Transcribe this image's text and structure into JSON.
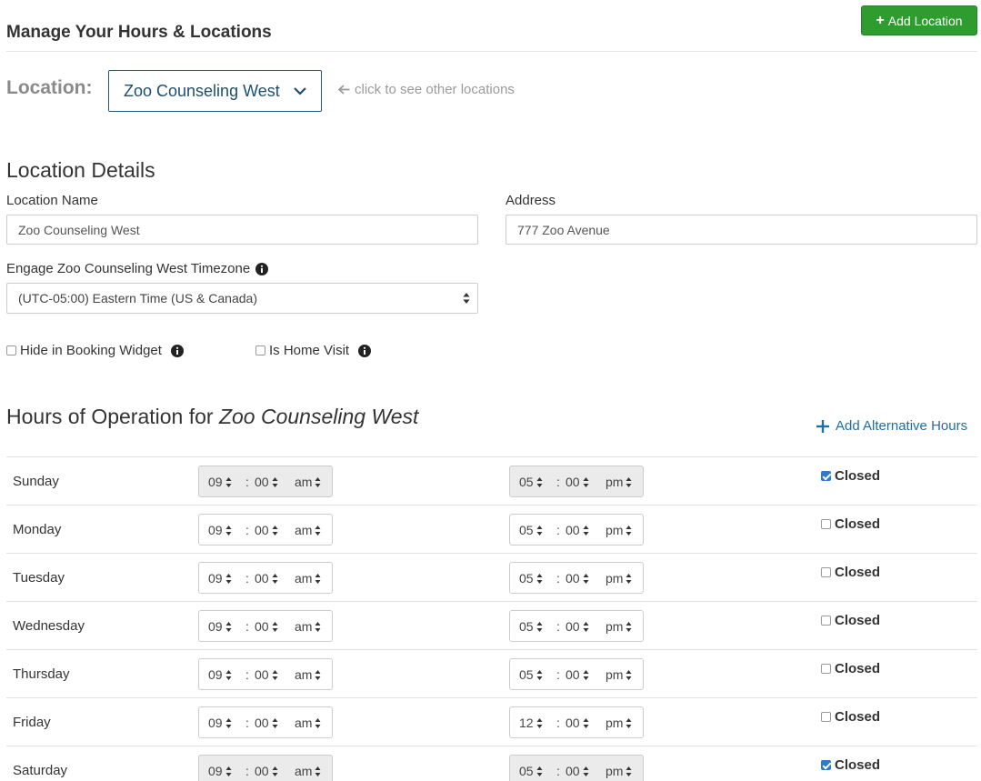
{
  "header": {
    "title": "Manage Your Hours & Locations",
    "add_location_label": "Add Location"
  },
  "location_picker": {
    "label": "Location:",
    "selected": "Zoo Counseling West",
    "hint": "click to see other locations"
  },
  "details": {
    "heading": "Location Details",
    "name_label": "Location Name",
    "name_value": "Zoo Counseling West",
    "address_label": "Address",
    "address_value": "777 Zoo Avenue",
    "timezone_label": "Engage Zoo Counseling West Timezone",
    "timezone_value": "(UTC-05:00) Eastern Time (US & Canada)",
    "hide_booking_label": "Hide in Booking Widget",
    "hide_booking_checked": false,
    "home_visit_label": "Is Home Visit",
    "home_visit_checked": false
  },
  "hours": {
    "heading_prefix": "Hours of Operation for",
    "heading_location": "Zoo Counseling West",
    "add_alt_label": "Add Alternative Hours",
    "colon": ":",
    "closed_label": "Closed",
    "days": [
      {
        "name": "Sunday",
        "open_h": "09",
        "open_m": "00",
        "open_ap": "am",
        "close_h": "05",
        "close_m": "00",
        "close_ap": "pm",
        "closed": true
      },
      {
        "name": "Monday",
        "open_h": "09",
        "open_m": "00",
        "open_ap": "am",
        "close_h": "05",
        "close_m": "00",
        "close_ap": "pm",
        "closed": false
      },
      {
        "name": "Tuesday",
        "open_h": "09",
        "open_m": "00",
        "open_ap": "am",
        "close_h": "05",
        "close_m": "00",
        "close_ap": "pm",
        "closed": false
      },
      {
        "name": "Wednesday",
        "open_h": "09",
        "open_m": "00",
        "open_ap": "am",
        "close_h": "05",
        "close_m": "00",
        "close_ap": "pm",
        "closed": false
      },
      {
        "name": "Thursday",
        "open_h": "09",
        "open_m": "00",
        "open_ap": "am",
        "close_h": "05",
        "close_m": "00",
        "close_ap": "pm",
        "closed": false
      },
      {
        "name": "Friday",
        "open_h": "09",
        "open_m": "00",
        "open_ap": "am",
        "close_h": "12",
        "close_m": "00",
        "close_ap": "pm",
        "closed": false
      },
      {
        "name": "Saturday",
        "open_h": "09",
        "open_m": "00",
        "open_ap": "am",
        "close_h": "05",
        "close_m": "00",
        "close_ap": "pm",
        "closed": true
      }
    ]
  },
  "colors": {
    "primary_green": "#2f9c2f",
    "link_blue": "#1e6fa5",
    "checkbox_blue": "#2a7bd0",
    "disabled_gray": "#ebebeb"
  }
}
